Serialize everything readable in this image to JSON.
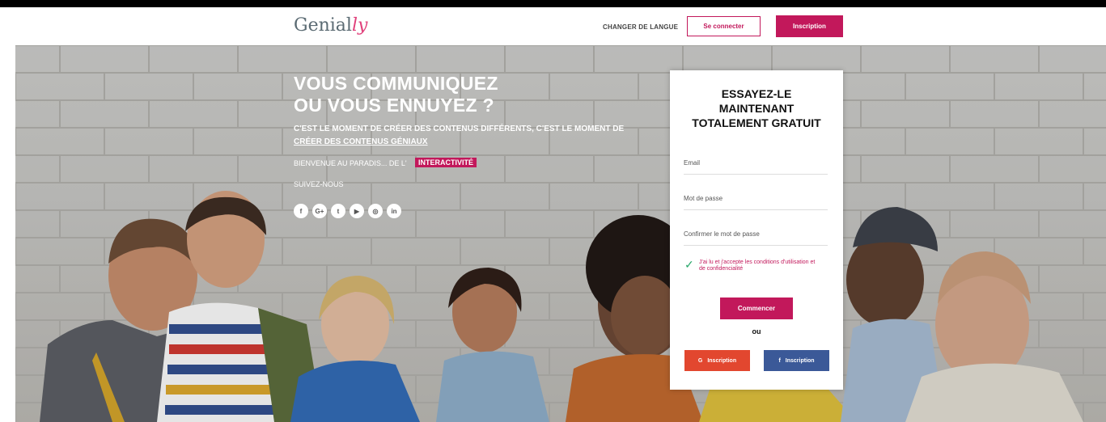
{
  "header": {
    "logo_main": "Genial",
    "logo_tail": "ly",
    "change_language": "CHANGER DE LANGUE",
    "login_label": "Se connecter",
    "signup_label": "Inscription"
  },
  "hero": {
    "headline_1": "VOUS COMMUNIQUEZ",
    "headline_2": "OU VOUS ENNUYEZ ?",
    "sub_part1": "C'EST LE MOMENT DE CRÉER DES CONTENUS DIFFÉRENTS, C'EST LE MOMENT DE ",
    "sub_link": "CRÉER DES CONTENUS GÉNIAUX",
    "welcome": "BIENVENUE AU PARADIS... DE L'",
    "tag": "INTERACTIVITÉ",
    "follow": "SUIVEZ-NOUS",
    "socials": [
      {
        "icon": "facebook-icon",
        "glyph": "f"
      },
      {
        "icon": "google-plus-icon",
        "glyph": "G+"
      },
      {
        "icon": "twitter-icon",
        "glyph": "t"
      },
      {
        "icon": "youtube-icon",
        "glyph": "▶"
      },
      {
        "icon": "instagram-icon",
        "glyph": "◎"
      },
      {
        "icon": "linkedin-icon",
        "glyph": "in"
      }
    ]
  },
  "signup_card": {
    "title_1": "ESSAYEZ-LE",
    "title_2": "MAINTENANT",
    "title_3": "TOTALEMENT GRATUIT",
    "email_placeholder": "Email",
    "password_placeholder": "Mot de passe",
    "confirm_placeholder": "Confirmer le mot de passe",
    "terms": "J'ai lu et j'accepte les conditions d'utilisation et de confidencialité",
    "start_label": "Commencer",
    "or_label": "ou",
    "google_label": "Inscription",
    "google_glyph": "G",
    "facebook_label": "Inscription",
    "facebook_glyph": "f"
  },
  "colors": {
    "brand": "#c2185b",
    "google": "#e2472f",
    "facebook": "#3b5998"
  }
}
